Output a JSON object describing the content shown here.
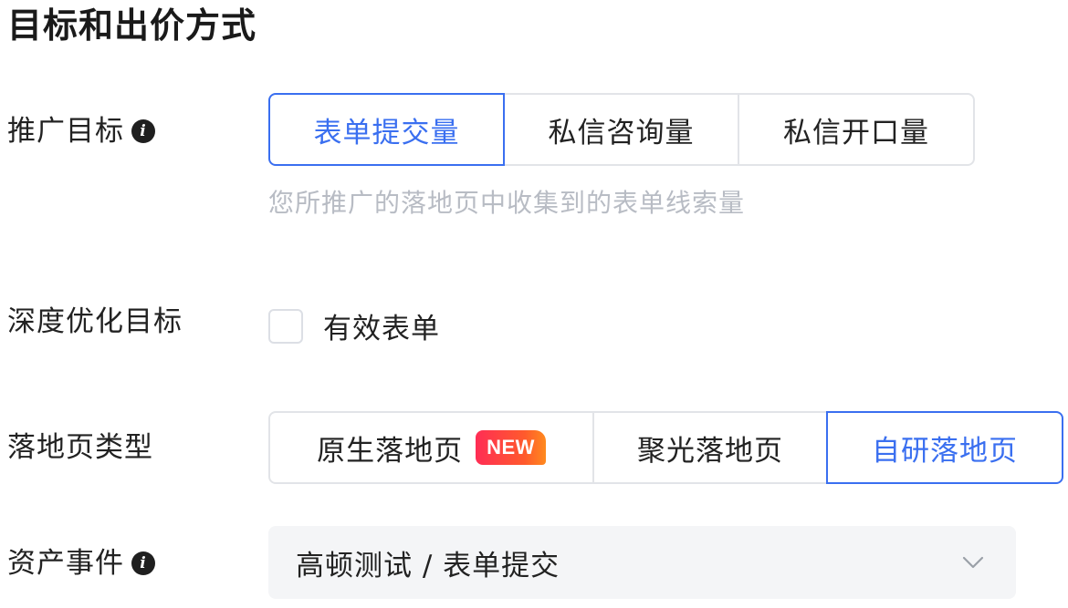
{
  "section": {
    "title": "目标和出价方式"
  },
  "goal": {
    "label": "推广目标",
    "info_icon": "info-icon",
    "options": [
      {
        "label": "表单提交量",
        "selected": true
      },
      {
        "label": "私信咨询量",
        "selected": false
      },
      {
        "label": "私信开口量",
        "selected": false
      }
    ],
    "hint": "您所推广的落地页中收集到的表单线索量"
  },
  "deep_optimization": {
    "label": "深度优化目标",
    "checkbox_label": "有效表单",
    "checked": false
  },
  "landing_page_type": {
    "label": "落地页类型",
    "options": [
      {
        "label": "原生落地页",
        "badge": "NEW",
        "selected": false
      },
      {
        "label": "聚光落地页",
        "selected": false
      },
      {
        "label": "自研落地页",
        "selected": true
      }
    ]
  },
  "asset_event": {
    "label": "资产事件",
    "info_icon": "info-icon",
    "value": "高顿测试 / 表单提交",
    "dropdown_icon": "chevron-down-icon"
  },
  "colors": {
    "accent": "#3a6ff0",
    "border": "#e2e4e8",
    "hint_text": "#b8bcc4",
    "select_bg": "#f4f5f7",
    "badge_gradient_start": "#ff2d55",
    "badge_gradient_end": "#ff8a1e"
  }
}
